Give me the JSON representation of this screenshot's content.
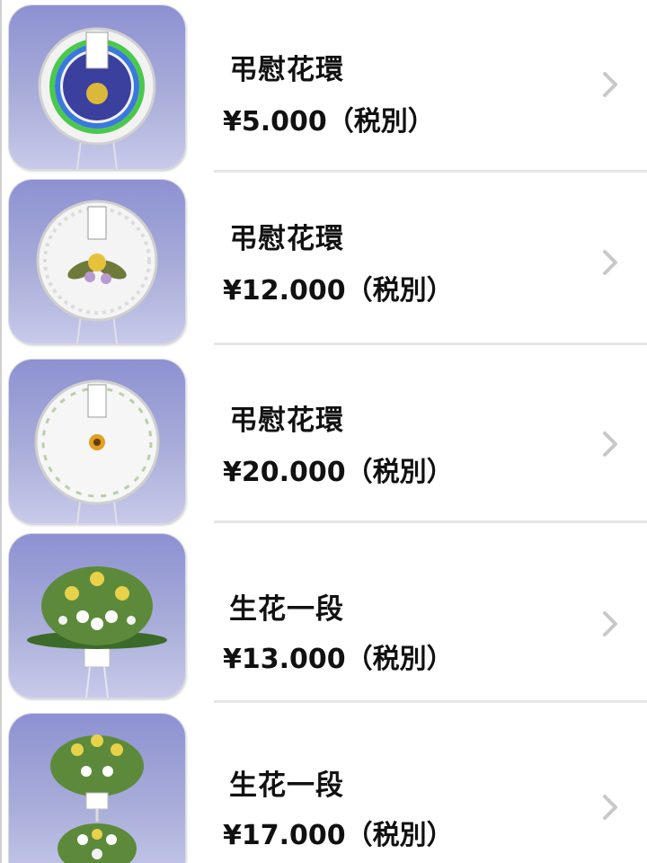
{
  "items": [
    {
      "name": "弔慰花環",
      "price": "¥5.000（税別）",
      "image": "wreath-emblem"
    },
    {
      "name": "弔慰花環",
      "price": "¥12.000（税別）",
      "image": "wreath-lily"
    },
    {
      "name": "弔慰花環",
      "price": "¥20.000（税別）",
      "image": "wreath-white"
    },
    {
      "name": "生花一段",
      "price": "¥13.000（税別）",
      "image": "flower-stand-one-tier"
    },
    {
      "name": "生花一段",
      "price": "¥17.000（税別）",
      "image": "flower-stand-two-tier"
    }
  ],
  "icons": {
    "chevron": "chevron-right-icon"
  },
  "colors": {
    "thumb_bg": "#8d91d2",
    "chevron": "#c8c8c8",
    "separator": "#e6e6e6"
  }
}
